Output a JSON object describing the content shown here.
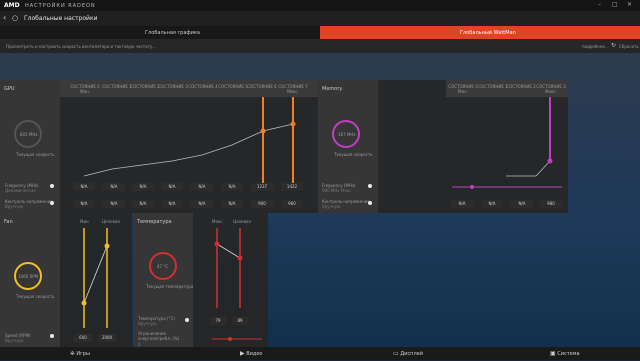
{
  "app": {
    "logo": "AMD",
    "title": "НАСТРОЙКИ RADEON"
  },
  "header": {
    "title": "Глобальные настройки"
  },
  "tabs": [
    {
      "label": "Глобальная графика"
    },
    {
      "label": "Глобальный WattMan"
    }
  ],
  "hint": {
    "text": "Просмотреть и настроить скорость вентилятора и тактовую частоту...",
    "more": "подробнее...",
    "reset": "Сбросить"
  },
  "gpu": {
    "section_label": "GPU",
    "states": [
      "СОСТОЯНИЕ 0 Мин.",
      "СОСТОЯНИЕ 1",
      "СОСТОЯНИЕ 2",
      "СОСТОЯНИЕ 3",
      "СОСТОЯНИЕ 4",
      "СОСТОЯНИЕ 5",
      "СОСТОЯНИЕ 6",
      "СОСТОЯНИЕ 7 Макс."
    ],
    "gauge_value": "602 MHz",
    "gauge_caption": "Текущая скорость",
    "freq_label": "Frequency (MHz)",
    "freq_sub": "Динамическая",
    "volt_label": "Контроль напряжения",
    "volt_sub": "Вручную",
    "freq_cells": [
      "N/A",
      "N/A",
      "N/A",
      "N/A",
      "N/A",
      "N/A",
      "1237",
      "1422"
    ],
    "volt_cells": [
      "N/A",
      "N/A",
      "N/A",
      "N/A",
      "N/A",
      "N/A",
      "900",
      "960"
    ]
  },
  "memory": {
    "section_label": "Memory",
    "states": [
      "СОСТОЯНИЕ 0 Мин.",
      "СОСТОЯНИЕ 1",
      "СОСТОЯНИЕ 2",
      "СОСТОЯНИЕ 3 Макс."
    ],
    "gauge_value": "167 MHz",
    "gauge_caption": "Текущая скорость",
    "freq_label": "Frequency (MHz)",
    "freq_sub": "900 MHz Макс.",
    "volt_label": "Контроль напряжения",
    "volt_sub": "Вручную",
    "volt_cells": [
      "N/A",
      "N/A",
      "N/A",
      "980"
    ]
  },
  "fan": {
    "section_label": "Fan",
    "min_label": "Мин",
    "target_label": "Целевая",
    "gauge_value": "1066 RPM",
    "gauge_caption": "Текущая скорость",
    "speed_label": "Speed (RPM)",
    "speed_sub": "Вручную",
    "cells": [
      "600",
      "2000"
    ]
  },
  "temperature": {
    "section_label": "Температура",
    "max_label": "Макс",
    "target_label": "Целевая",
    "gauge_value": "47 °C",
    "gauge_caption": "Текущая температура",
    "temp_label": "Температура (°C)",
    "temp_sub": "Вручную",
    "power_label": "Ограничение энергопотребл. (%)",
    "power_sub": "0",
    "cells": [
      "79",
      "89"
    ]
  },
  "nav": [
    {
      "label": "Игры"
    },
    {
      "label": "Видео"
    },
    {
      "label": "Дисплей"
    },
    {
      "label": "Система"
    }
  ],
  "colors": {
    "accent": "#e04420",
    "gpu_line": "#f08020",
    "memory_line": "#c040c0",
    "fan_line": "#f0c020",
    "temp_line": "#d03030"
  }
}
